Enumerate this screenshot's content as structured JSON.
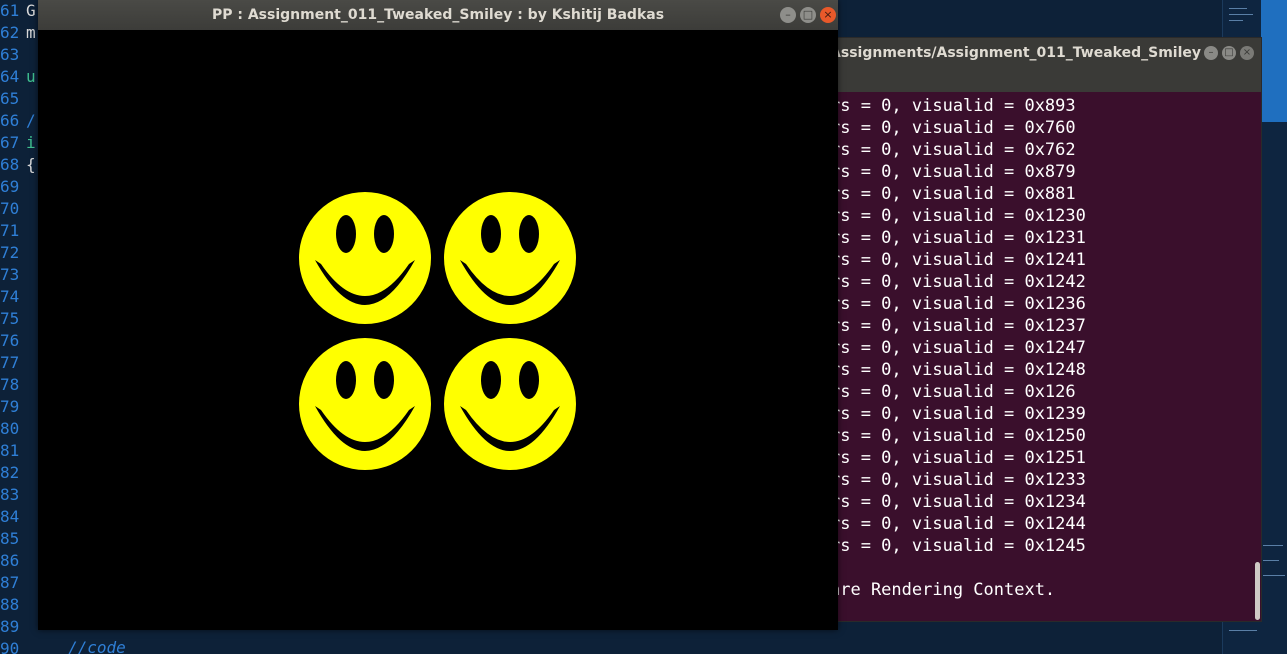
{
  "editor": {
    "line_numbers": [
      "61",
      "62",
      "63",
      "64",
      "65",
      "66",
      "67",
      "68",
      "69",
      "70",
      "71",
      "72",
      "73",
      "74",
      "75",
      "76",
      "77",
      "78",
      "79",
      "80",
      "81",
      "82",
      "83",
      "84",
      "85",
      "86",
      "87",
      "88",
      "89",
      "90"
    ],
    "visible_fragments": {
      "line_61": "G",
      "line_62": "m",
      "line_64": "u",
      "line_66": "/",
      "line_67": "i",
      "line_68": "{"
    },
    "comment": "//code"
  },
  "terminal": {
    "title": "ws/Assignments/Assignment_011_Tweaked_Smiley",
    "lines": [
      "rs = 0, visualid = 0x893",
      "rs = 0, visualid = 0x760",
      "rs = 0, visualid = 0x762",
      "rs = 0, visualid = 0x879",
      "rs = 0, visualid = 0x881",
      "rs = 0, visualid = 0x1230",
      "rs = 0, visualid = 0x1231",
      "rs = 0, visualid = 0x1241",
      "rs = 0, visualid = 0x1242",
      "rs = 0, visualid = 0x1236",
      "rs = 0, visualid = 0x1237",
      "rs = 0, visualid = 0x1247",
      "rs = 0, visualid = 0x1248",
      "rs = 0, visualid = 0x126",
      "rs = 0, visualid = 0x1239",
      "rs = 0, visualid = 0x1250",
      "rs = 0, visualid = 0x1251",
      "rs = 0, visualid = 0x1233",
      "rs = 0, visualid = 0x1234",
      "rs = 0, visualid = 0x1244",
      "rs = 0, visualid = 0x1245",
      "",
      "are Rendering Context."
    ],
    "buttons": {
      "minimize": "–",
      "maximize": "□",
      "close": "×"
    }
  },
  "gl_window": {
    "title": "PP : Assignment_011_Tweaked_Smiley : by Kshitij Badkas",
    "buttons": {
      "minimize": "–",
      "maximize": "□",
      "close": "×"
    },
    "background_color": "#000000",
    "smiley_color": "#ffff00",
    "smiley_count": 4
  }
}
